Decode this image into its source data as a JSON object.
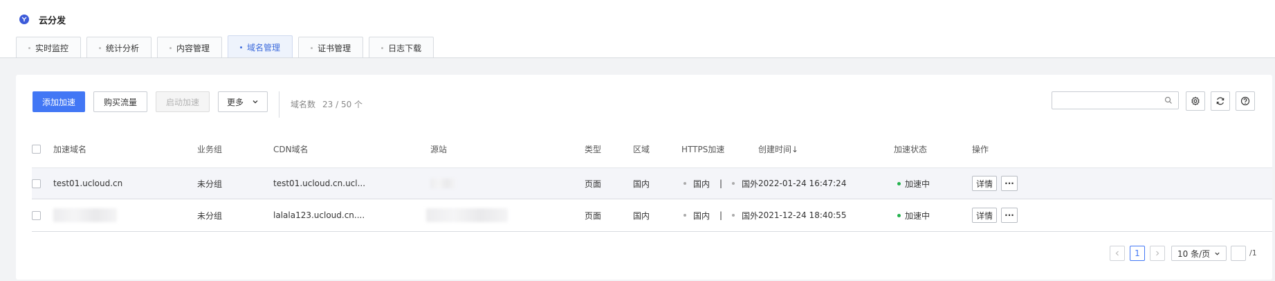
{
  "app": {
    "title": "云分发",
    "logo_icon": "ucloud-logo-icon"
  },
  "tabs": [
    {
      "label": "实时监控",
      "active": false
    },
    {
      "label": "统计分析",
      "active": false
    },
    {
      "label": "内容管理",
      "active": false
    },
    {
      "label": "域名管理",
      "active": true
    },
    {
      "label": "证书管理",
      "active": false
    },
    {
      "label": "日志下载",
      "active": false
    }
  ],
  "toolbar": {
    "add_label": "添加加速",
    "buy_label": "购买流量",
    "start_label": "启动加速",
    "more_label": "更多",
    "count_label": "域名数",
    "count_value": "23 / 50 个",
    "search_placeholder": ""
  },
  "table": {
    "columns": [
      "加速域名",
      "业务组",
      "CDN域名",
      "源站",
      "类型",
      "区域",
      "HTTPS加速",
      "创建时间↓",
      "加速状态",
      "操作"
    ],
    "rows": [
      {
        "domain": "test01.ucloud.cn",
        "group": "未分组",
        "cdn": "test01.ucloud.cn.ucl...",
        "type": "页面",
        "region": "国内",
        "https_domestic": "国内",
        "https_sep": "|",
        "https_foreign": "国外",
        "created": "2022-01-24 16:47:24",
        "status": "加速中",
        "detail": "详情",
        "more": "···"
      },
      {
        "domain": "",
        "group": "未分组",
        "cdn": "lalala123.ucloud.cn....",
        "type": "页面",
        "region": "国内",
        "https_domestic": "国内",
        "https_sep": "|",
        "https_foreign": "国外",
        "created": "2021-12-24 18:40:55",
        "status": "加速中",
        "detail": "详情",
        "more": "···"
      }
    ]
  },
  "pagination": {
    "current": "1",
    "page_size": "10 条/页",
    "total_pages": "/1"
  },
  "colors": {
    "primary": "#4277f5",
    "active_tab": "#3d6bdc",
    "status_green": "#22b14c"
  }
}
